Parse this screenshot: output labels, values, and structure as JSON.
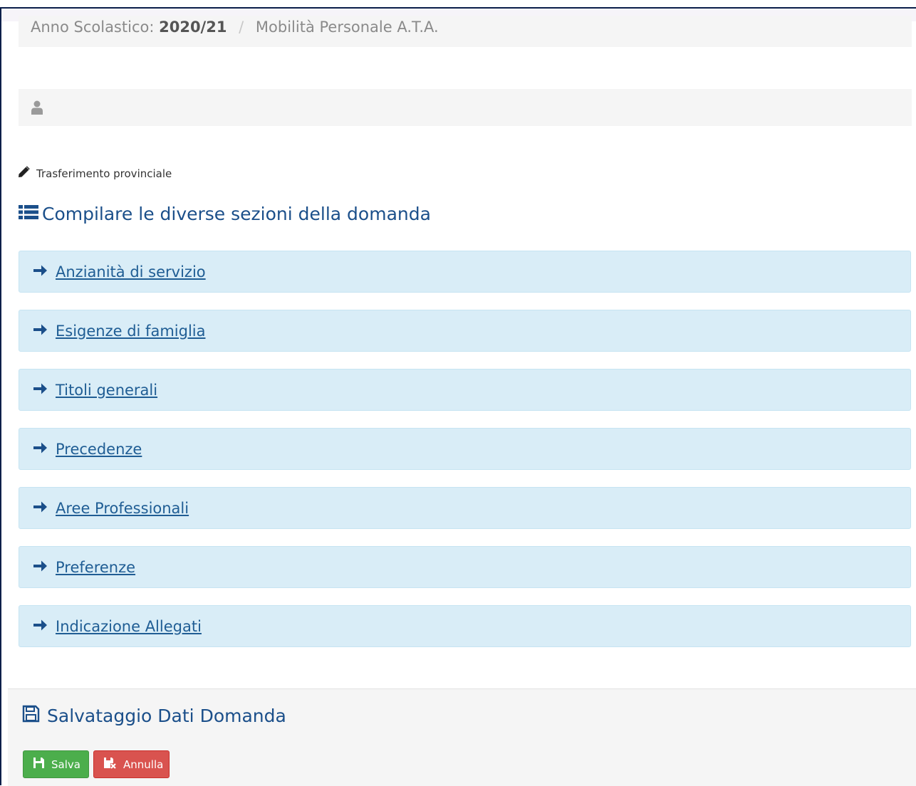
{
  "breadcrumb": {
    "year_label": "Anno Scolastico:",
    "year_value": "2020/21",
    "separator": "/",
    "current": "Mobilità Personale A.T.A."
  },
  "user": {
    "icon": "user-icon",
    "name": ""
  },
  "subtitle": {
    "icon": "pencil-icon",
    "text": "Trasferimento provinciale"
  },
  "sections": {
    "icon": "list-icon",
    "title": "Compilare le diverse sezioni della domanda",
    "items": [
      {
        "label": "Anzianità di servizio",
        "icon": "arrow-right-icon"
      },
      {
        "label": "Esigenze di famiglia",
        "icon": "arrow-right-icon"
      },
      {
        "label": "Titoli generali",
        "icon": "arrow-right-icon"
      },
      {
        "label": "Precedenze",
        "icon": "arrow-right-icon"
      },
      {
        "label": "Aree Professionali",
        "icon": "arrow-right-icon"
      },
      {
        "label": "Preferenze",
        "icon": "arrow-right-icon"
      },
      {
        "label": "Indicazione Allegati",
        "icon": "arrow-right-icon"
      }
    ]
  },
  "save_panel": {
    "icon": "floppy-disk-icon",
    "title": "Salvataggio Dati Domanda",
    "save_label": "Salva",
    "cancel_label": "Annulla"
  },
  "colors": {
    "accent": "#1b4f8a",
    "link": "#1f5d94",
    "accordion_bg": "#d9edf7",
    "save_button": "#4cae4c",
    "cancel_button": "#d9534f"
  }
}
